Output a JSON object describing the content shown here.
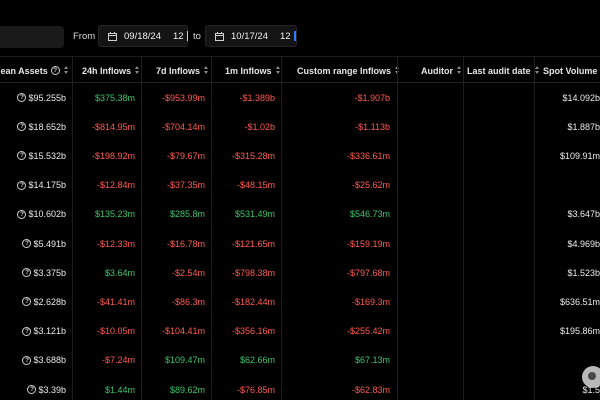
{
  "filter": {
    "from_label": "From",
    "to_label": "to",
    "from_date": "09/18/24",
    "from_hour": "12",
    "to_date": "10/17/24",
    "to_hour": "12"
  },
  "columns": [
    {
      "label": "lean Assets",
      "sortable": true,
      "info": true
    },
    {
      "label": "24h Inflows",
      "sortable": true
    },
    {
      "label": "7d Inflows",
      "sortable": true
    },
    {
      "label": "1m Inflows",
      "sortable": true
    },
    {
      "label": "Custom range Inflows",
      "sortable": true
    },
    {
      "label": "Auditor",
      "sortable": true
    },
    {
      "label": "Last audit date",
      "sortable": true
    },
    {
      "label": "Spot Volume",
      "sortable": true
    }
  ],
  "rows": [
    {
      "assets": "$95.255b",
      "h24": "$375.38m",
      "d7": "-$953.99m",
      "m1": "-$1.389b",
      "custom": "-$1.907b",
      "auditor": "",
      "audit_date": "",
      "spot": "$14.092b"
    },
    {
      "assets": "$18.652b",
      "h24": "-$814.95m",
      "d7": "-$704.14m",
      "m1": "-$1.02b",
      "custom": "-$1.113b",
      "auditor": "",
      "audit_date": "",
      "spot": "$1.887b"
    },
    {
      "assets": "$15.532b",
      "h24": "-$198.92m",
      "d7": "-$79.67m",
      "m1": "-$315.28m",
      "custom": "-$336.61m",
      "auditor": "",
      "audit_date": "",
      "spot": "$109.91m"
    },
    {
      "assets": "$14.175b",
      "h24": "-$12.84m",
      "d7": "-$37.35m",
      "m1": "-$48.15m",
      "custom": "-$25.62m",
      "auditor": "",
      "audit_date": "",
      "spot": ""
    },
    {
      "assets": "$10.602b",
      "h24": "$135.23m",
      "d7": "$285.8m",
      "m1": "$531.49m",
      "custom": "$546.73m",
      "auditor": "",
      "audit_date": "",
      "spot": "$3.647b"
    },
    {
      "assets": "$5.491b",
      "h24": "-$12.33m",
      "d7": "-$16.78m",
      "m1": "-$121.65m",
      "custom": "-$159.19m",
      "auditor": "",
      "audit_date": "",
      "spot": "$4.969b"
    },
    {
      "assets": "$3.375b",
      "h24": "$3.64m",
      "d7": "-$2.54m",
      "m1": "-$798.38m",
      "custom": "-$797.68m",
      "auditor": "",
      "audit_date": "",
      "spot": "$1.523b"
    },
    {
      "assets": "$2.628b",
      "h24": "-$41.41m",
      "d7": "-$86.3m",
      "m1": "-$182.44m",
      "custom": "-$169.3m",
      "auditor": "",
      "audit_date": "",
      "spot": "$636.51m"
    },
    {
      "assets": "$3.121b",
      "h24": "-$10.05m",
      "d7": "-$104.41m",
      "m1": "-$356.16m",
      "custom": "-$255.42m",
      "auditor": "",
      "audit_date": "",
      "spot": "$195.86m"
    },
    {
      "assets": "$3.688b",
      "h24": "-$7.24m",
      "d7": "$109.47m",
      "m1": "$62.66m",
      "custom": "$67.13m",
      "auditor": "",
      "audit_date": "",
      "spot": ""
    },
    {
      "assets": "$3.39b",
      "h24": "$1.44m",
      "d7": "$89.62m",
      "m1": "-$76.85m",
      "custom": "-$62.83m",
      "auditor": "",
      "audit_date": "",
      "spot": "$1.5"
    }
  ],
  "colors": {
    "positive": "#3cc46b",
    "negative": "#ff5a4e",
    "background": "#000000"
  }
}
